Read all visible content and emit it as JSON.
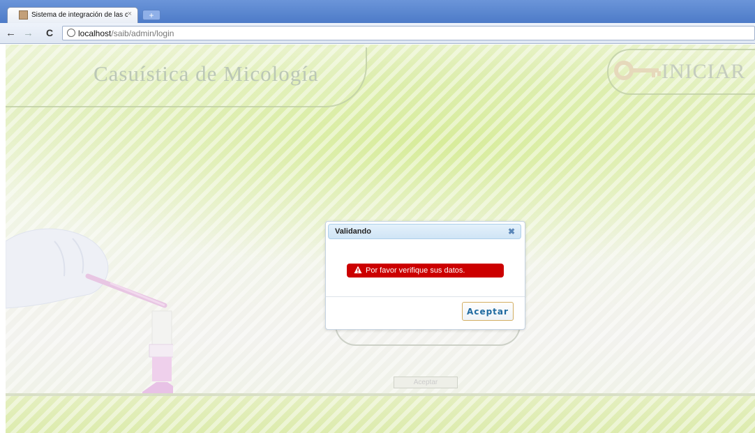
{
  "browser": {
    "tab_title": "Sistema de integración de las c",
    "tab_close": "×",
    "new_tab": "+",
    "url_host": "localhost",
    "url_path": "/saib/admin/login",
    "back": "←",
    "forward": "→",
    "reload": "C"
  },
  "page": {
    "site_title": "Casuística de Micología",
    "login_title": "INICIAR",
    "bg_accept_label": "Aceptar"
  },
  "dialog": {
    "title": "Validando",
    "close": "✖",
    "message": "Por favor verifique sus datos.",
    "button_label": "Aceptar"
  },
  "colors": {
    "alert": "#cc0000",
    "header": "#cfe4f5",
    "button_text": "#1f6aa0"
  },
  "icons": [
    "favicon-icon",
    "close-icon",
    "new-tab-icon",
    "back-icon",
    "forward-icon",
    "reload-icon",
    "globe-icon",
    "key-icon",
    "warning-icon",
    "dialog-close-icon"
  ]
}
